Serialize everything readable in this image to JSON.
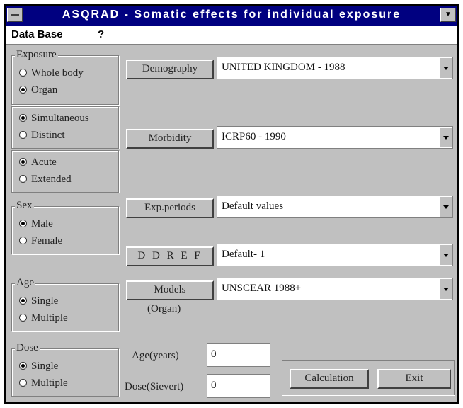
{
  "window": {
    "title": "ASQRAD - Somatic effects for individual exposure"
  },
  "menu": {
    "items": [
      "Data Base",
      "?"
    ]
  },
  "exposure": {
    "legend": "Exposure",
    "options": [
      "Whole body",
      "Organ"
    ],
    "timing": [
      "Simultaneous",
      "Distinct"
    ],
    "duration": [
      "Acute",
      "Extended"
    ]
  },
  "sex": {
    "legend": "Sex",
    "options": [
      "Male",
      "Female"
    ]
  },
  "age": {
    "legend": "Age",
    "options": [
      "Single",
      "Multiple"
    ]
  },
  "dose": {
    "legend": "Dose",
    "options": [
      "Single",
      "Multiple"
    ]
  },
  "demography": {
    "button": "Demography",
    "value": "UNITED KINGDOM - 1988"
  },
  "morbidity": {
    "button": "Morbidity",
    "value": "ICRP60 - 1990"
  },
  "exp_periods": {
    "button": "Exp.periods",
    "value": "Default values"
  },
  "ddref": {
    "button": "D D R E F",
    "value": "Default- 1"
  },
  "models": {
    "button": "Models",
    "sublabel": "(Organ)",
    "value": "UNSCEAR 1988+"
  },
  "inputs": {
    "age_label": "Age(years)",
    "age_value": "0",
    "dose_label": "Dose(Sievert)",
    "dose_value": "0"
  },
  "actions": {
    "calculation": "Calculation",
    "exit": "Exit"
  }
}
